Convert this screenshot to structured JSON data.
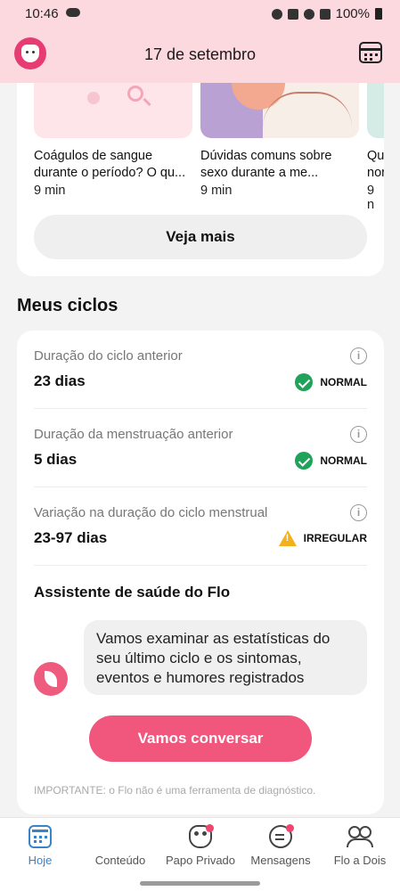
{
  "status_bar": {
    "time": "10:46",
    "battery": "100%"
  },
  "header": {
    "date": "17 de setembro"
  },
  "articles": [
    {
      "title": "Coágulos de sangue durante o período? O qu...",
      "time": "9 min"
    },
    {
      "title": "Dúvidas comuns sobre sexo durante a me...",
      "time": "9 min"
    },
    {
      "title": "Qu... nor...",
      "time": "9 n"
    }
  ],
  "see_more_label": "Veja mais",
  "cycles": {
    "section_title": "Meus ciclos",
    "stats": [
      {
        "label": "Duração do ciclo anterior",
        "value": "23 dias",
        "status": "NORMAL",
        "status_color": "#1fa35a"
      },
      {
        "label": "Duração da menstruação anterior",
        "value": "5 dias",
        "status": "NORMAL",
        "status_color": "#1fa35a"
      },
      {
        "label": "Variação na duração do ciclo menstrual",
        "value": "23-97 dias",
        "status": "IRREGULAR",
        "status_color": "#f3b21c"
      }
    ],
    "assistant_title": "Assistente de saúde do Flo",
    "assistant_message": "Vamos examinar as estatísticas do seu último ciclo e os sintomas, eventos e humores registrados",
    "talk_button": "Vamos conversar",
    "disclaimer": "IMPORTANTE: o Flo não é uma ferramenta de diagnóstico."
  },
  "nav": [
    {
      "label": "Hoje",
      "icon": "calendar-today-icon",
      "active": true
    },
    {
      "label": "Conteúdo",
      "icon": "content-grid-icon",
      "active": false
    },
    {
      "label": "Papo Privado",
      "icon": "mask-icon",
      "active": false,
      "badge": true
    },
    {
      "label": "Mensagens",
      "icon": "chat-icon",
      "active": false,
      "badge": true
    },
    {
      "label": "Flo a Dois",
      "icon": "couple-icon",
      "active": false
    }
  ],
  "colors": {
    "header_bg": "#fcd8df",
    "accent": "#f1577c",
    "active_nav": "#3b83c7"
  }
}
